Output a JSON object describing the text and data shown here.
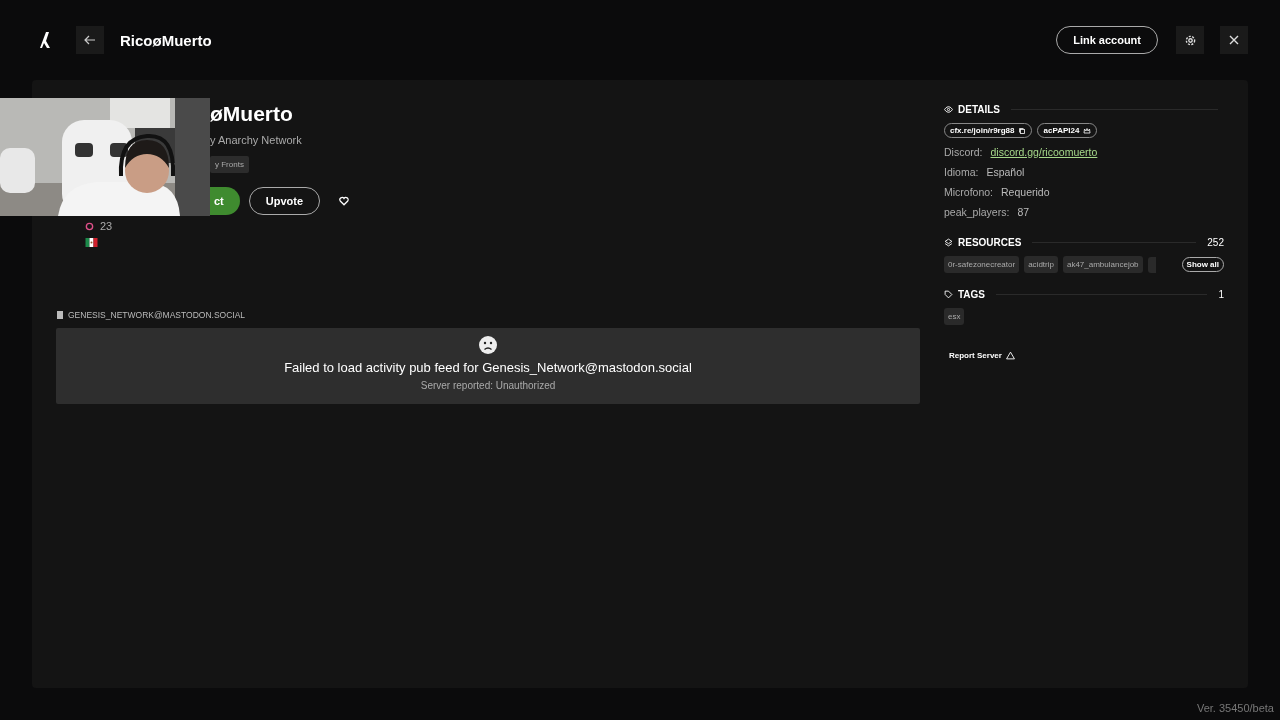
{
  "topbar": {
    "title": "RicoøMuerto",
    "link_button": "Link account"
  },
  "server": {
    "title": "øMuerto",
    "subtitle": "y Anarchy Network",
    "tag": "y Fronts",
    "connect": "ct",
    "upvote": "Upvote",
    "count": "23"
  },
  "feed": {
    "label": "GENESIS_NETWORK@MASTODON.SOCIAL",
    "error": "Failed to load activity pub feed for Genesis_Network@mastodon.social",
    "reason": "Server reported: Unauthorized"
  },
  "details": {
    "heading": "DETAILS",
    "chips": [
      {
        "label": "cfx.re/join/r9rg88",
        "kind": "copy"
      },
      {
        "label": "acPAPI24",
        "kind": "crown"
      }
    ],
    "fields": [
      {
        "key": "Discord:",
        "value": "discord.gg/ricoomuerto",
        "kind": "link"
      },
      {
        "key": "Idioma:",
        "value": "Español",
        "kind": "text"
      },
      {
        "key": "Microfono:",
        "value": "Requerido",
        "kind": "text"
      },
      {
        "key": "peak_players:",
        "value": "87",
        "kind": "text"
      }
    ]
  },
  "resources": {
    "heading": "RESOURCES",
    "count": "252",
    "items": [
      "0r-safezonecreator",
      "acidtrip",
      "ak47_ambulancejob"
    ],
    "show_all": "Show all"
  },
  "tags": {
    "heading": "TAGS",
    "count": "1",
    "items": [
      "esx"
    ]
  },
  "report": "Report Server",
  "version": "Ver. 35450/beta"
}
